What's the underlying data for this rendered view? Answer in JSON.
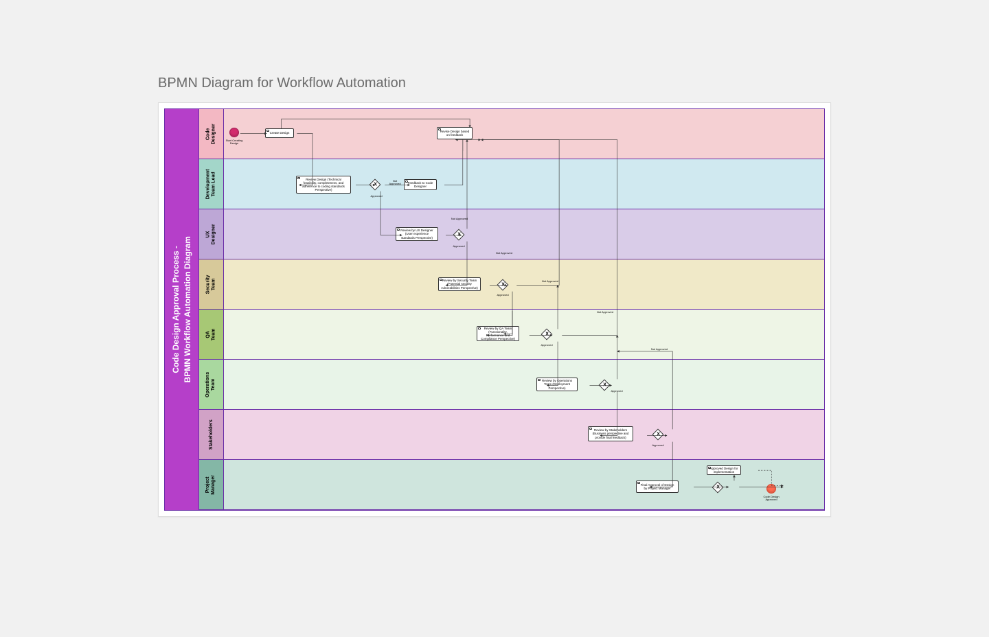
{
  "page_title": "BPMN Diagram for Workflow Automation",
  "pool_title_line1": "Code Design Approval Process -",
  "pool_title_line2": "BPMN Workflow Automation Diagram",
  "lanes": [
    {
      "label": "Code\nDesigner"
    },
    {
      "label": "Development\nTeam Lead"
    },
    {
      "label": "UX\nDesigner"
    },
    {
      "label": "Security\nTeam"
    },
    {
      "label": "QA\nTeam"
    },
    {
      "label": "Operations\nTeam"
    },
    {
      "label": "Stakeholders"
    },
    {
      "label": "Project\nManager"
    }
  ],
  "start_event_label": "Start Creating Design",
  "end_event_label": "Code Design Approved",
  "tasks": {
    "create_design": "Create Design",
    "revise_design": "Revise Design based on feedback",
    "review_dev": "Review Design (Technical feasibility, completeness, and adherence to coding standards Perspective)",
    "feedback_to_designer": "Feedback to Code Designer",
    "review_ux": "Review by UX Designer (User experience standards Perspective)",
    "review_security": "Review by Security Team (Potential security vulnerabilities Perspective)",
    "review_qa": "Review by QA Team (Functionality, Performance and Compliance Perspective)",
    "review_ops": "Review by Operations Team (Deployment Perspective)",
    "review_stakeholders": "Review by Stakeholders (Business perspective and provide final feedback)",
    "final_approval": "Final Approval of Design by Project Manager",
    "approved_impl": "Approved Design for implementation"
  },
  "gateway_labels": {
    "approved": "Approved",
    "not_approved": "Not Approved",
    "not_approved2": "Not Approved",
    "not_approved3": "Not Approved"
  }
}
